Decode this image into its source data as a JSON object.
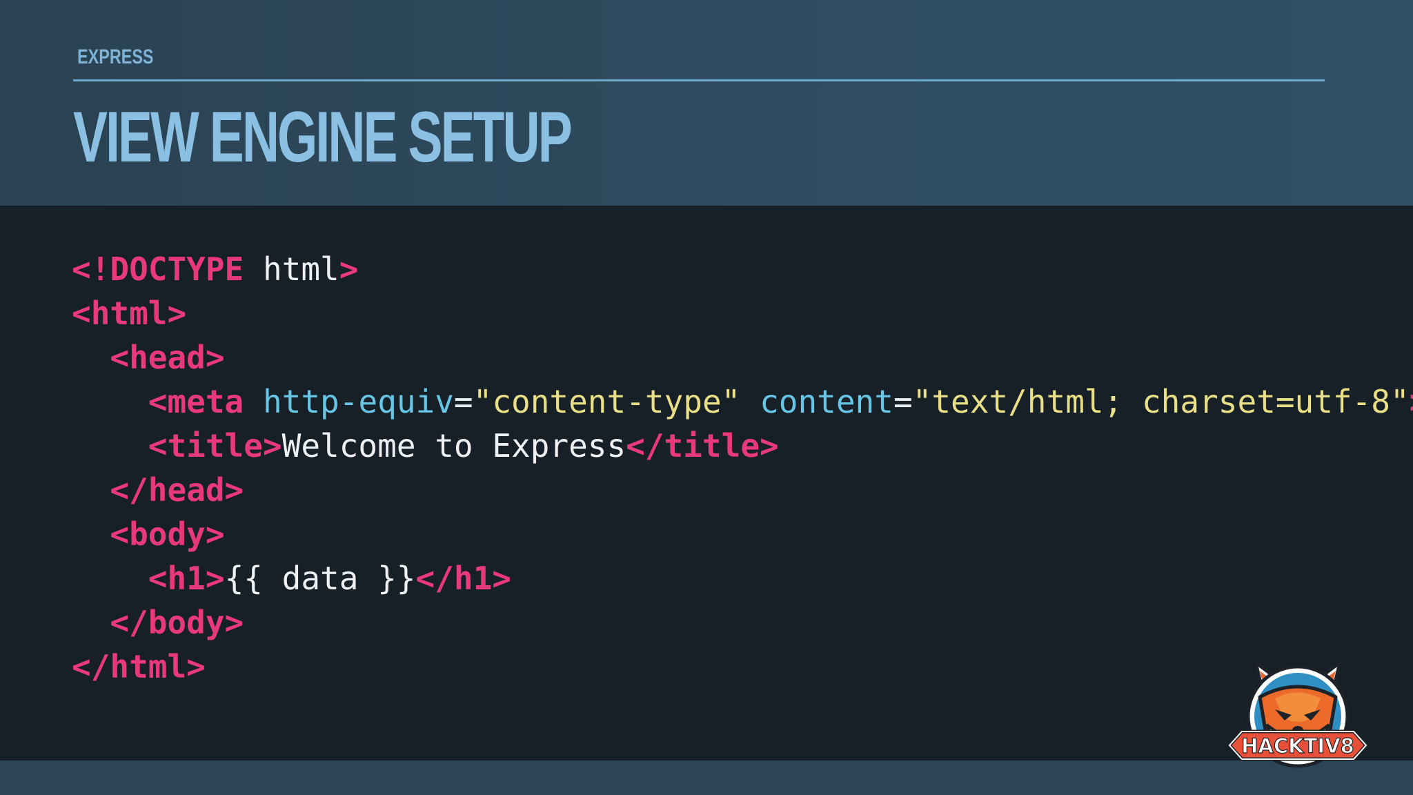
{
  "header": {
    "section_label": "EXPRESS",
    "title": "VIEW ENGINE SETUP"
  },
  "code": {
    "lines": [
      {
        "indent": "",
        "parts": [
          [
            "tag",
            "<!DOCTYPE"
          ],
          [
            "txt",
            " html"
          ],
          [
            "tag",
            ">"
          ]
        ]
      },
      {
        "indent": "",
        "parts": [
          [
            "tag",
            "<html>"
          ]
        ]
      },
      {
        "indent": "  ",
        "parts": [
          [
            "tag",
            "<head>"
          ]
        ]
      },
      {
        "indent": "    ",
        "parts": [
          [
            "tag",
            "<meta"
          ],
          [
            "txt",
            " "
          ],
          [
            "attr",
            "http-equiv"
          ],
          [
            "eq",
            "="
          ],
          [
            "str",
            "\"content-type\""
          ],
          [
            "txt",
            " "
          ],
          [
            "attr",
            "content"
          ],
          [
            "eq",
            "="
          ],
          [
            "str",
            "\"text/html; charset=utf-8\""
          ],
          [
            "tag",
            ">"
          ]
        ]
      },
      {
        "indent": "    ",
        "parts": [
          [
            "tag",
            "<title>"
          ],
          [
            "txt",
            "Welcome to Express"
          ],
          [
            "tag",
            "</title>"
          ]
        ]
      },
      {
        "indent": "  ",
        "parts": [
          [
            "tag",
            "</head>"
          ]
        ]
      },
      {
        "indent": "  ",
        "parts": [
          [
            "tag",
            "<body>"
          ]
        ]
      },
      {
        "indent": "    ",
        "parts": [
          [
            "tag",
            "<h1>"
          ],
          [
            "txt",
            "{{ data }}"
          ],
          [
            "tag",
            "</h1>"
          ]
        ]
      },
      {
        "indent": "  ",
        "parts": [
          [
            "tag",
            "</body>"
          ]
        ]
      },
      {
        "indent": "",
        "parts": [
          [
            "tag",
            "</html>"
          ]
        ]
      }
    ]
  },
  "logo": {
    "text": "HACKTIV8",
    "icon": "fox-mascot-icon"
  },
  "colors": {
    "tag": "#e8397a",
    "attribute": "#67c6e6",
    "string": "#e8df86",
    "text": "#eef1f3",
    "title": "#8cc0e2",
    "code_background": "#171f27",
    "header_background": "#2c4557"
  }
}
